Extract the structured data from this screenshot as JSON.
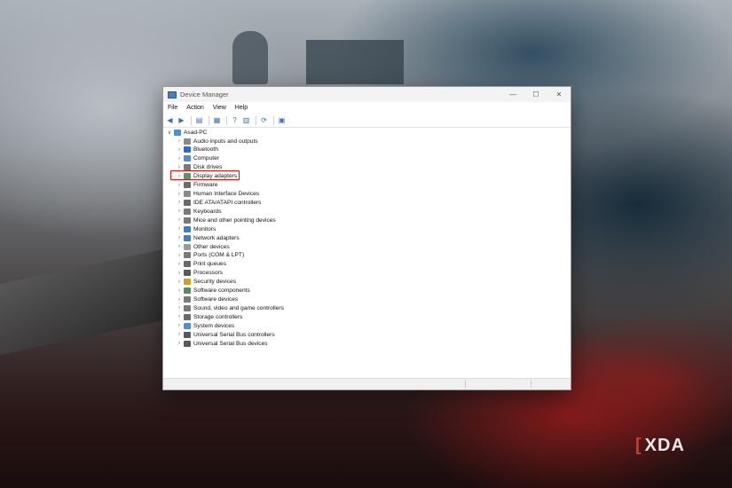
{
  "window": {
    "title": "Device Manager",
    "minimize_glyph": "—",
    "maximize_glyph": "☐",
    "close_glyph": "✕"
  },
  "menu": [
    "File",
    "Action",
    "View",
    "Help"
  ],
  "toolbar": [
    {
      "name": "back-icon",
      "glyph": "◀"
    },
    {
      "name": "forward-icon",
      "glyph": "▶"
    },
    {
      "name": "properties-icon",
      "glyph": "▤"
    },
    {
      "name": "list-view-icon",
      "glyph": "▦"
    },
    {
      "name": "help-icon",
      "glyph": "?"
    },
    {
      "name": "details-icon",
      "glyph": "▥"
    },
    {
      "name": "update-driver-icon",
      "glyph": "⟳"
    },
    {
      "name": "scan-hardware-icon",
      "glyph": "▣"
    }
  ],
  "tree": {
    "root": "Asad-PC",
    "root_chevron": "∨",
    "item_chevron": "›",
    "items": [
      {
        "label": "Audio inputs and outputs",
        "icon": "speaker-icon",
        "color": "#8a8a8a"
      },
      {
        "label": "Bluetooth",
        "icon": "bluetooth-icon",
        "color": "#1f6fd6"
      },
      {
        "label": "Computer",
        "icon": "computer-icon",
        "color": "#4f8fcf"
      },
      {
        "label": "Disk drives",
        "icon": "disk-icon",
        "color": "#7a7a7a"
      },
      {
        "label": "Display adapters",
        "icon": "display-adapter-icon",
        "color": "#4f9a6a"
      },
      {
        "label": "Firmware",
        "icon": "firmware-icon",
        "color": "#6a6a6a"
      },
      {
        "label": "Human Interface Devices",
        "icon": "hid-icon",
        "color": "#8a8a8a"
      },
      {
        "label": "IDE ATA/ATAPI controllers",
        "icon": "ide-icon",
        "color": "#6a6a6a"
      },
      {
        "label": "Keyboards",
        "icon": "keyboard-icon",
        "color": "#7a7a7a"
      },
      {
        "label": "Mice and other pointing devices",
        "icon": "mouse-icon",
        "color": "#7a7a7a"
      },
      {
        "label": "Monitors",
        "icon": "monitor-icon",
        "color": "#3a7fcf"
      },
      {
        "label": "Network adapters",
        "icon": "network-icon",
        "color": "#3a7fcf"
      },
      {
        "label": "Other devices",
        "icon": "other-devices-icon",
        "color": "#9a9a9a"
      },
      {
        "label": "Ports (COM & LPT)",
        "icon": "port-icon",
        "color": "#7a7a7a"
      },
      {
        "label": "Print queues",
        "icon": "printer-icon",
        "color": "#6a6a6a"
      },
      {
        "label": "Processors",
        "icon": "processor-icon",
        "color": "#5a5a5a"
      },
      {
        "label": "Security devices",
        "icon": "security-icon",
        "color": "#c9a227"
      },
      {
        "label": "Software components",
        "icon": "software-components-icon",
        "color": "#5a8a6a"
      },
      {
        "label": "Software devices",
        "icon": "software-devices-icon",
        "color": "#7a7a7a"
      },
      {
        "label": "Sound, video and game controllers",
        "icon": "sound-icon",
        "color": "#7a7a7a"
      },
      {
        "label": "Storage controllers",
        "icon": "storage-icon",
        "color": "#6a6a6a"
      },
      {
        "label": "System devices",
        "icon": "system-devices-icon",
        "color": "#4f8fcf"
      },
      {
        "label": "Universal Serial Bus controllers",
        "icon": "usb-icon",
        "color": "#5a5a5a"
      },
      {
        "label": "Universal Serial Bus devices",
        "icon": "usb-device-icon",
        "color": "#5a5a5a"
      }
    ]
  },
  "highlighted_item": "Display adapters",
  "colors": {
    "highlight": "#d0181a"
  },
  "watermark": {
    "bracket": "[",
    "text": "XDA"
  }
}
